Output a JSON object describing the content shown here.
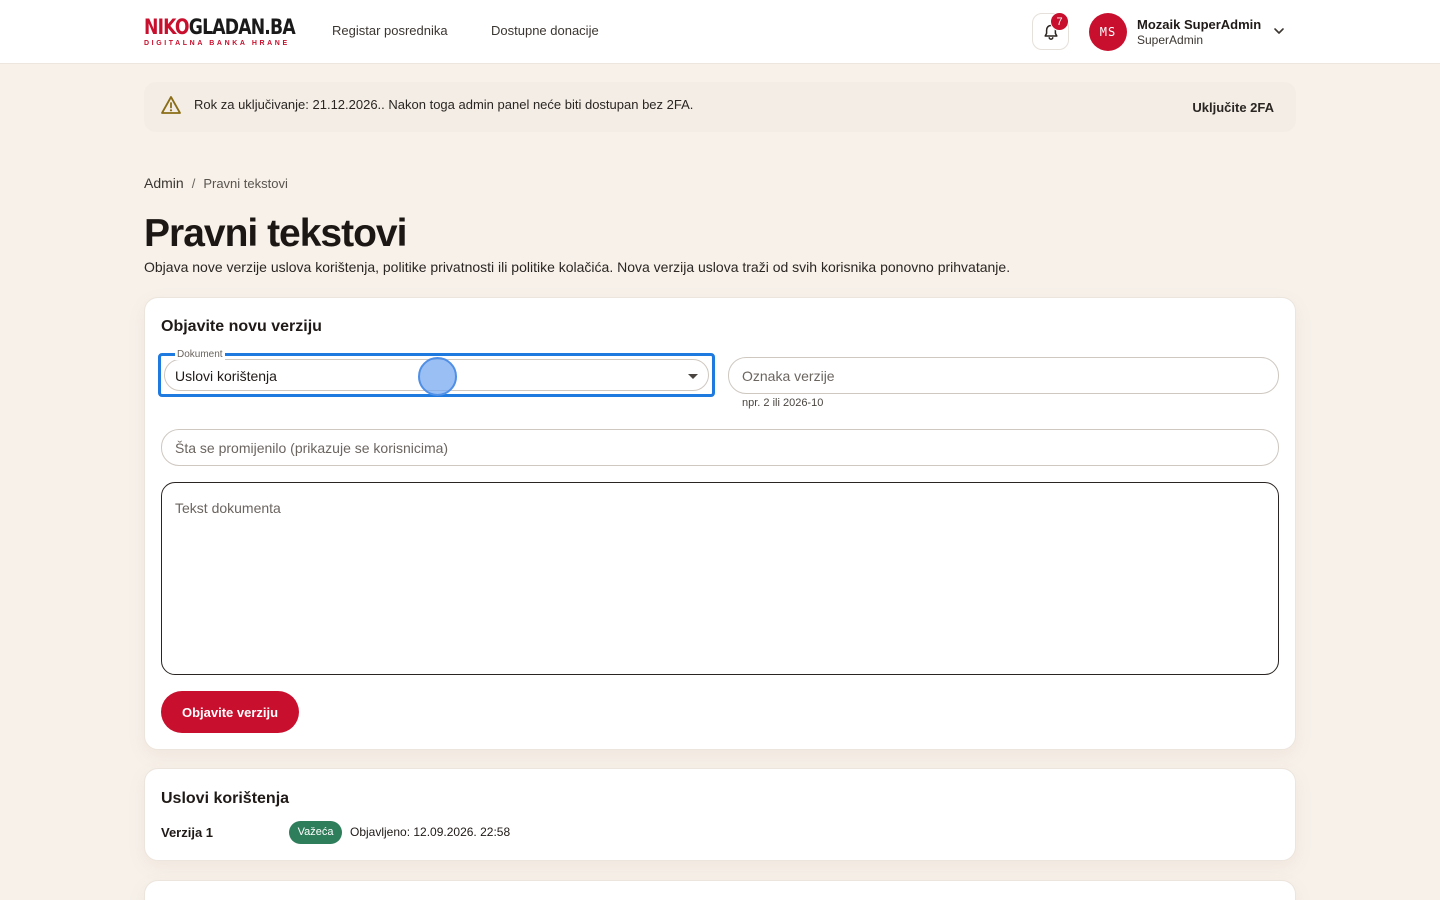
{
  "header": {
    "logo_main_red": "NIKO",
    "logo_main_dark": "GLADAN.BA",
    "logo_sub": "DIGITALNA BANKA HRANE",
    "nav": [
      "Registar posrednika",
      "Dostupne donacije"
    ],
    "notifications_count": "7",
    "user": {
      "initials": "MS",
      "name": "Mozaik SuperAdmin",
      "role": "SuperAdmin"
    }
  },
  "alert": {
    "text": "Rok za uključivanje: 21.12.2026.. Nakon toga admin panel neće biti dostupan bez 2FA.",
    "action": "Uključite 2FA"
  },
  "breadcrumb": {
    "root": "Admin",
    "separator": "/",
    "current": "Pravni tekstovi"
  },
  "page": {
    "title": "Pravni tekstovi",
    "description": "Objava nove verzije uslova korištenja, politike privatnosti ili politike kolačića. Nova verzija uslova traži od svih korisnika ponovno prihvatanje."
  },
  "form": {
    "title": "Objavite novu verziju",
    "document_label": "Dokument",
    "document_value": "Uslovi korištenja",
    "version_placeholder": "Oznaka verzije",
    "version_helper": "npr. 2 ili 2026-10",
    "changes_placeholder": "Šta se promijenilo (prikazuje se korisnicima)",
    "text_placeholder": "Tekst dokumenta",
    "submit": "Objavite verziju"
  },
  "documents": [
    {
      "title": "Uslovi korištenja",
      "version": "Verzija 1",
      "status": "Važeća",
      "published": "Objavljeno: 12.09.2026. 22:58"
    }
  ],
  "colors": {
    "brand": "#c8102e",
    "focus": "#1f7ae0",
    "success": "#2e7d5b",
    "background": "#f7f1ea"
  }
}
